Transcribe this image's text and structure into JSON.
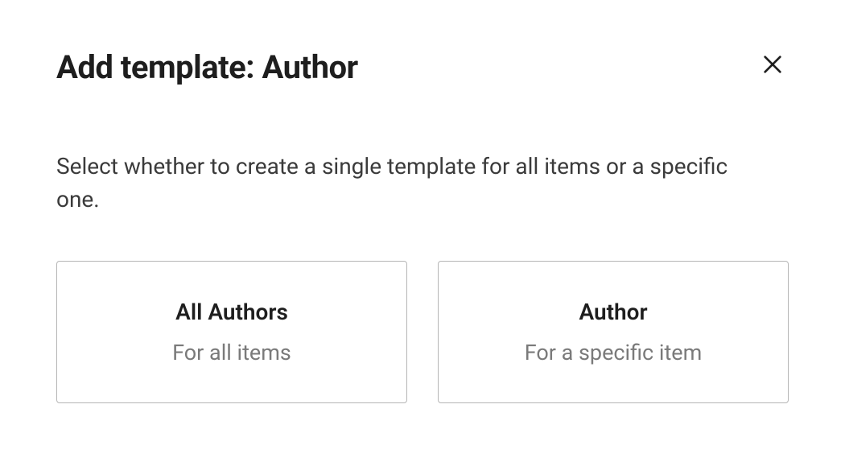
{
  "modal": {
    "title": "Add template: Author",
    "description": "Select whether to create a single template for all items or a specific one.",
    "options": [
      {
        "title": "All Authors",
        "subtitle": "For all items"
      },
      {
        "title": "Author",
        "subtitle": "For a specific item"
      }
    ]
  }
}
